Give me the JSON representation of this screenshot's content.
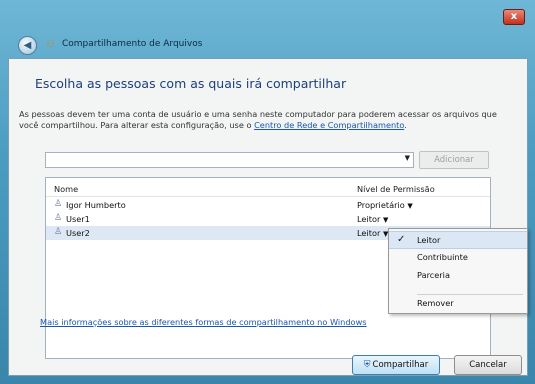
{
  "window": {
    "title": "Compartilhamento de Arquivos",
    "close_label": "x"
  },
  "main": {
    "heading": "Escolha as pessoas com as quais irá compartilhar",
    "description": "As pessoas devem ter uma conta de usuário e uma senha neste computador para poderem acessar os arquivos que você compartilhou. Para alterar esta configuração, use o",
    "network_link": "Centro de Rede e Compartilhamento",
    "add_button": "Adicionar",
    "table": {
      "columns": [
        "Nome",
        "Nível de Permissão"
      ],
      "rows": [
        {
          "name": "Igor Humberto",
          "permission": "Proprietário"
        },
        {
          "name": "User1",
          "permission": "Leitor"
        },
        {
          "name": "User2",
          "permission": "Leitor"
        }
      ]
    },
    "permission_menu": {
      "items": [
        "Leitor",
        "Contribuinte",
        "Parceria",
        "Remover"
      ],
      "selected": "Leitor"
    },
    "more_info_link": "Mais informações sobre as diferentes formas de compartilhamento no Windows"
  },
  "footer": {
    "share_button": "Compartilhar",
    "cancel_button": "Cancelar"
  }
}
